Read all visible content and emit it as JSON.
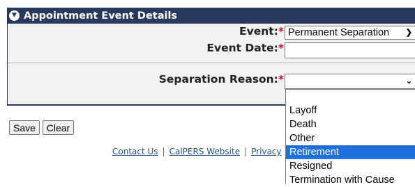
{
  "panel": {
    "title": "Appointment Event Details",
    "icon": "circle-chevron-down-icon"
  },
  "form": {
    "event": {
      "label": "Event:",
      "required_mark": "*",
      "value": "Permanent Separation"
    },
    "event_date": {
      "label": "Event Date:",
      "required_mark": "*",
      "value": ""
    },
    "separation_reason": {
      "label": "Separation Reason:",
      "required_mark": "*",
      "value": ""
    }
  },
  "dropdown": {
    "options": [
      "",
      "Layoff",
      "Death",
      "Other",
      "Retirement",
      "Resigned",
      "Termination with Cause"
    ],
    "highlighted": "Retirement",
    "highlight_color": "#1e6fdc"
  },
  "buttons": {
    "save": "Save",
    "clear": "Clear"
  },
  "footer": {
    "contact_us": "Contact Us",
    "separator": "|",
    "calpers_website": "CalPERS Website",
    "privacy": "Privacy"
  },
  "colors": {
    "header_bg": "#29395d",
    "required": "#c8102e",
    "panel_bg": "#f2f2f2"
  }
}
